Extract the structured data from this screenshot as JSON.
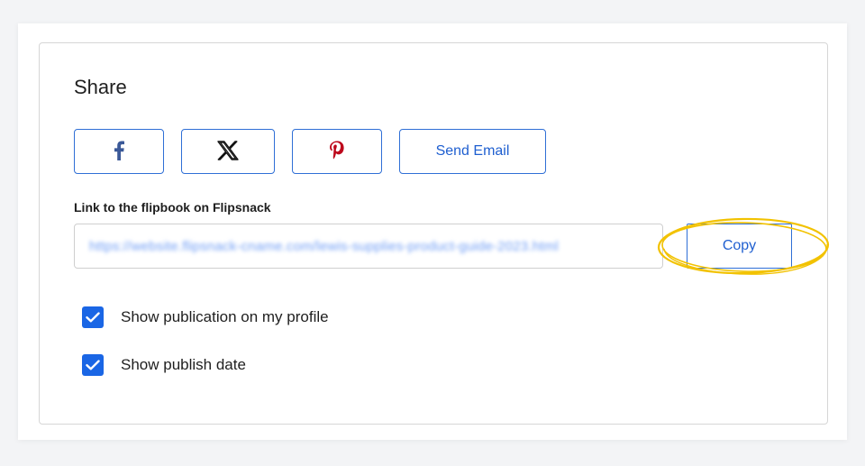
{
  "share": {
    "title": "Share",
    "buttons": {
      "facebook_icon": "facebook-icon",
      "x_icon": "x-icon",
      "pinterest_icon": "pinterest-icon",
      "send_email_label": "Send Email"
    },
    "link_label": "Link to the flipbook on Flipsnack",
    "link_value": "https://website.flipsnack-cname.com/lewis-supplies-product-guide-2023.html",
    "copy_label": "Copy",
    "options": [
      {
        "label": "Show publication on my profile",
        "checked": true
      },
      {
        "label": "Show publish date",
        "checked": true
      }
    ]
  },
  "colors": {
    "accent": "#1a66e5",
    "button_border": "#2f6fd6",
    "button_text": "#1f5fd0",
    "facebook": "#3b5998",
    "pinterest": "#bd081c",
    "highlight": "#f2c200"
  }
}
